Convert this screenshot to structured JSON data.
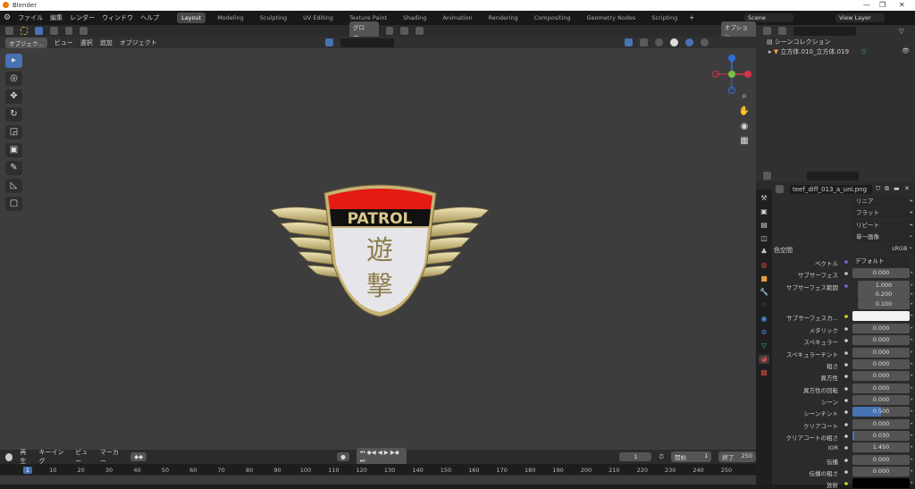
{
  "window": {
    "title": "Blender",
    "minimize": "—",
    "maximize": "❐",
    "close": "✕"
  },
  "menu": [
    "ファイル",
    "編集",
    "レンダー",
    "ウィンドウ",
    "ヘルプ"
  ],
  "workspaces": [
    "Layout",
    "Modeling",
    "Sculpting",
    "UV Editing",
    "Texture Paint",
    "Shading",
    "Animation",
    "Rendering",
    "Compositing",
    "Geometry Nodes",
    "Scripting"
  ],
  "add_tab": "+",
  "scene": {
    "name": "Scene",
    "view_layer": "View Layer"
  },
  "viewport": {
    "mode": "オブジェク...",
    "menus": [
      "ビュー",
      "選択",
      "追加",
      "オブジェクト"
    ],
    "transform": "グロー...",
    "options": "オプション"
  },
  "badge": {
    "top": "PATROL",
    "chars": [
      "遊",
      "撃"
    ]
  },
  "outliner": {
    "collection": "シーンコレクション",
    "object": "立方体.010_立方体.019"
  },
  "props": {
    "image": "teef_diff_013_a_uni.png",
    "dropdowns": [
      "リニア",
      "フラット",
      "リピート",
      "単一画像"
    ],
    "colorspace_label": "色空間",
    "colorspace": "sRGB",
    "vector_label": "ベクトル",
    "vector": "デフォルト",
    "rows": [
      {
        "label": "サブサーフェス",
        "value": "0.000"
      },
      {
        "label": "サブサーフェス範囲",
        "value": "1.000"
      },
      {
        "label": "",
        "value": "0.200"
      },
      {
        "label": "",
        "value": "0.100"
      },
      {
        "label": "サブサーフェスカ...",
        "value": ""
      },
      {
        "label": "メタリック",
        "value": "0.000"
      },
      {
        "label": "スペキュラー",
        "value": "0.000"
      },
      {
        "label": "スペキュラーチント",
        "value": "0.000"
      },
      {
        "label": "粗さ",
        "value": "0.000"
      },
      {
        "label": "異方性",
        "value": "0.000"
      },
      {
        "label": "異方性の回転",
        "value": "0.000"
      },
      {
        "label": "シーン",
        "value": "0.000"
      },
      {
        "label": "シーンチント",
        "value": "0.500",
        "fill": 0.5
      },
      {
        "label": "クリアコート",
        "value": "0.000"
      },
      {
        "label": "クリアコートの粗さ",
        "value": "0.030",
        "fill": 0.03
      },
      {
        "label": "IOR",
        "value": "1.450"
      },
      {
        "label": "伝播",
        "value": "0.000"
      },
      {
        "label": "伝播の粗さ",
        "value": "0.000"
      },
      {
        "label": "放射",
        "value": ""
      }
    ]
  },
  "timeline": {
    "menus": [
      "再生",
      "キーイング",
      "ビュー",
      "マーカー"
    ],
    "current": "1",
    "start_label": "開始",
    "start": "1",
    "end_label": "終了",
    "end": "250",
    "ticks": [
      "1",
      "10",
      "20",
      "30",
      "40",
      "50",
      "60",
      "70",
      "80",
      "90",
      "100",
      "110",
      "120",
      "130",
      "140",
      "150",
      "160",
      "170",
      "180",
      "190",
      "200",
      "210",
      "220",
      "230",
      "240",
      "250"
    ]
  }
}
